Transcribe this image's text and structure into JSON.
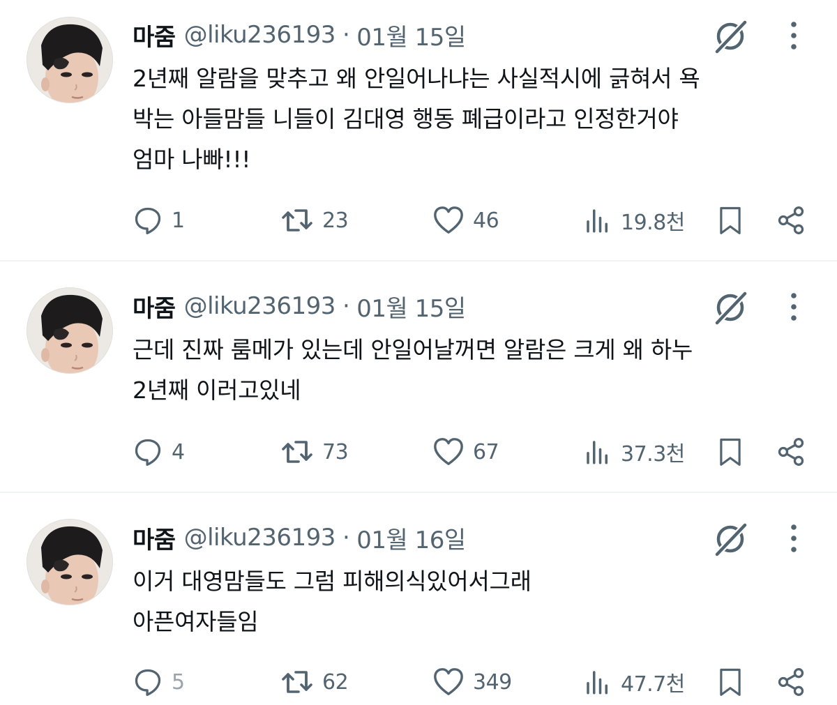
{
  "tweets": [
    {
      "name": "마줌",
      "handle": "@liku236193",
      "separator": "·",
      "date": "01월 15일",
      "text": [
        "2년째 알람을 맞추고 왜 안일어나냐는 사실적시에 긁혀서 욕",
        "박는 아들맘들 니들이 김대영 행동 폐급이라고 인정한거야",
        "엄마 나빠!!!"
      ],
      "replies": "1",
      "reposts": "23",
      "likes": "46",
      "views": "19.8천"
    },
    {
      "name": "마줌",
      "handle": "@liku236193",
      "separator": "·",
      "date": "01월 15일",
      "text": [
        "근데 진짜 룸메가 있는데 안일어날꺼면 알람은 크게 왜 하누",
        "2년째 이러고있네"
      ],
      "replies": "4",
      "reposts": "73",
      "likes": "67",
      "views": "37.3천"
    },
    {
      "name": "마줌",
      "handle": "@liku236193",
      "separator": "·",
      "date": "01월 16일",
      "text": [
        "이거 대영맘들도 그럼 피해의식있어서그래",
        "아픈여자들임"
      ],
      "replies": "5",
      "reposts": "62",
      "likes": "349",
      "views": "47.7천"
    }
  ],
  "icons": {
    "reply": "speech-bubble-icon",
    "repost": "repost-arrows-icon",
    "like": "heart-icon",
    "views": "bar-chart-icon",
    "bookmark": "bookmark-icon",
    "share": "share-icon",
    "grok": "grok-icon",
    "more": "vertical-ellipsis-icon"
  },
  "colors": {
    "text": "#0f1419",
    "secondary": "#536471",
    "divider": "#eff3f4"
  }
}
